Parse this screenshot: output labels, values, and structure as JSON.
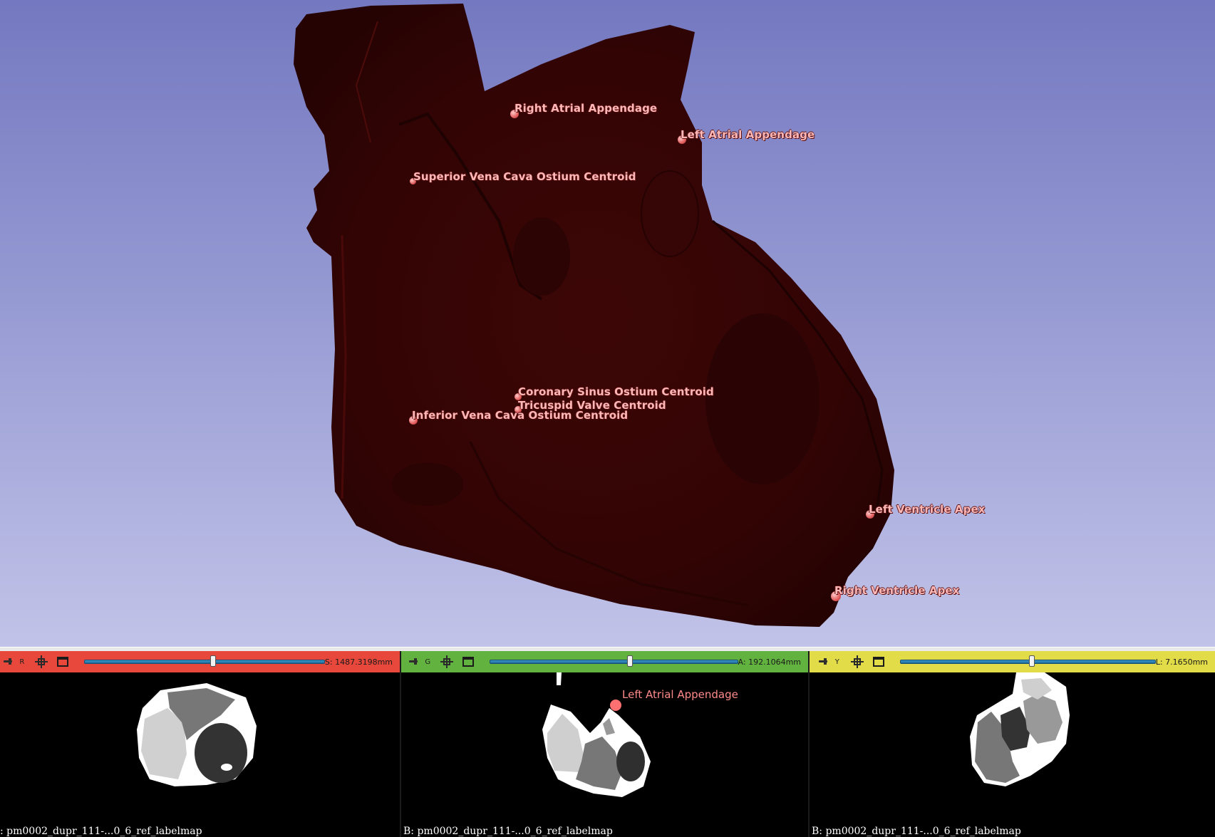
{
  "view3d": {
    "landmarks": [
      {
        "label": "Right Atrial Appendage"
      },
      {
        "label": "Left Atrial Appendage"
      },
      {
        "label": "Superior Vena Cava Ostium Centroid"
      },
      {
        "label": "Coronary Sinus Ostium Centroid"
      },
      {
        "label": "Tricuspid Valve Centroid"
      },
      {
        "label": "Inferior Vena Cava Ostium Centroid"
      },
      {
        "label": "Left Ventricle Apex"
      },
      {
        "label": "Right Ventricle Apex"
      }
    ],
    "colors": {
      "background_top": "#7478c0",
      "background_bottom": "#c1c3e8",
      "model": "#3a0606",
      "landmark": "#ffb8b8"
    }
  },
  "slices": {
    "red": {
      "letter": "R",
      "offset": "S: 1487.3198mm",
      "slider_fraction": 0.5,
      "volume_label": ": pm0002_dupr_111-...0_6_ref_labelmap",
      "color": "#e8483b"
    },
    "green": {
      "letter": "G",
      "offset": "A: 192.1064mm",
      "slider_fraction": 0.54,
      "volume_label": "B: pm0002_dupr_111-...0_6_ref_labelmap",
      "landmark_label": "Left Atrial Appendage",
      "color": "#62b23f"
    },
    "yellow": {
      "letter": "Y",
      "offset": "L: 7.1650mm",
      "slider_fraction": 0.5,
      "volume_label": "B: pm0002_dupr_111-...0_6_ref_labelmap",
      "color": "#e1dc48"
    }
  }
}
